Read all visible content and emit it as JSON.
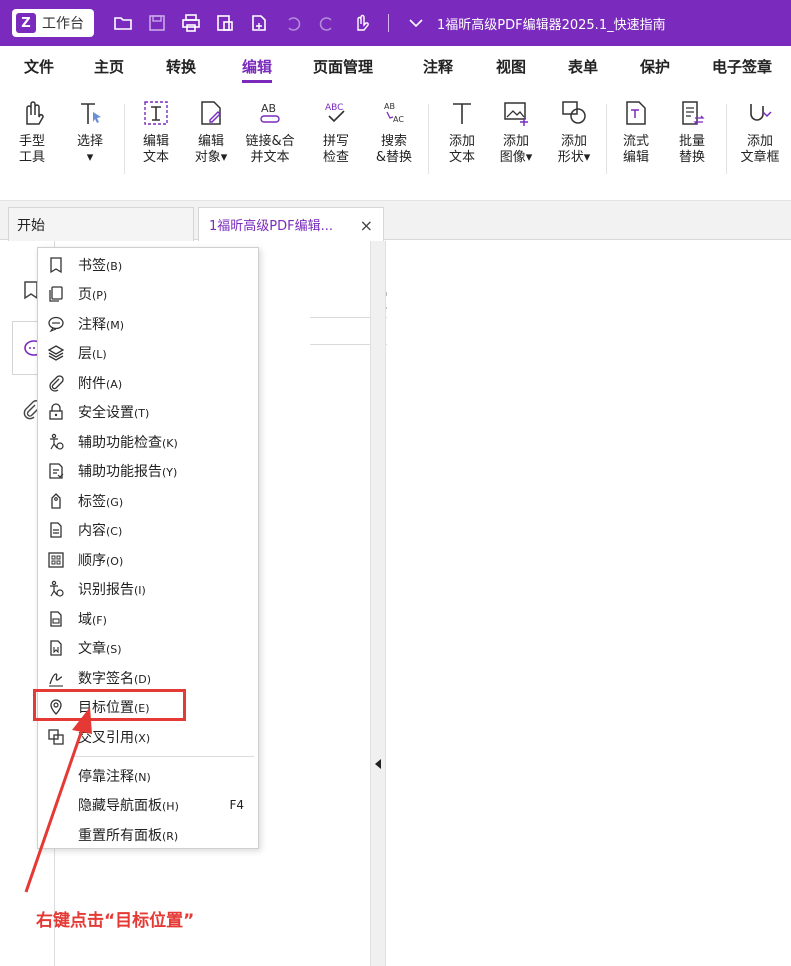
{
  "titlebar": {
    "workbench_label": "工作台",
    "logo_glyph": "Z",
    "doc_title": "1福昕高级PDF编辑器2025.1_快速指南"
  },
  "menu": {
    "tabs": [
      "文件",
      "主页",
      "转换",
      "编辑",
      "页面管理",
      "注释",
      "视图",
      "表单",
      "保护",
      "电子签章"
    ],
    "active": "编辑"
  },
  "ribbon": {
    "buttons": [
      {
        "l1": "手型",
        "l2": "工具",
        "icon": "hand-icon"
      },
      {
        "l1": "选择",
        "l2": "▾",
        "icon": "select-icon"
      },
      {
        "l1": "编辑",
        "l2": "文本",
        "icon": "edit-text-icon"
      },
      {
        "l1": "编辑",
        "l2": "对象▾",
        "icon": "edit-object-icon"
      },
      {
        "l1": "链接&合",
        "l2": "并文本",
        "icon": "link-merge-text-icon"
      },
      {
        "l1": "拼写",
        "l2": "检查",
        "icon": "spell-check-icon"
      },
      {
        "l1": "搜索",
        "l2": "&替换",
        "icon": "search-replace-icon"
      },
      {
        "l1": "添加",
        "l2": "文本",
        "icon": "add-text-icon"
      },
      {
        "l1": "添加",
        "l2": "图像▾",
        "icon": "add-image-icon"
      },
      {
        "l1": "添加",
        "l2": "形状▾",
        "icon": "add-shape-icon"
      },
      {
        "l1": "流式",
        "l2": "编辑",
        "icon": "flow-edit-icon"
      },
      {
        "l1": "批量",
        "l2": "替换",
        "icon": "batch-replace-icon"
      },
      {
        "l1": "添加",
        "l2": "文章框",
        "icon": "add-article-box-icon"
      }
    ]
  },
  "doctabs": {
    "home": "开始",
    "doc": "1福昕高级PDF编辑...",
    "close": "×"
  },
  "context_menu": {
    "items": [
      {
        "label": "书签",
        "acc": "(B)",
        "icon": "bookmark-icon"
      },
      {
        "label": "页",
        "acc": "(P)",
        "icon": "pages-icon"
      },
      {
        "label": "注释",
        "acc": "(M)",
        "icon": "comment-icon"
      },
      {
        "label": "层",
        "acc": "(L)",
        "icon": "layers-icon"
      },
      {
        "label": "附件",
        "acc": "(A)",
        "icon": "attachment-icon"
      },
      {
        "label": "安全设置",
        "acc": "(T)",
        "icon": "lock-icon"
      },
      {
        "label": "辅助功能检查",
        "acc": "(K)",
        "icon": "accessibility-check-icon"
      },
      {
        "label": "辅助功能报告",
        "acc": "(Y)",
        "icon": "accessibility-report-icon"
      },
      {
        "label": "标签",
        "acc": "(G)",
        "icon": "tag-icon"
      },
      {
        "label": "内容",
        "acc": "(C)",
        "icon": "content-icon"
      },
      {
        "label": "顺序",
        "acc": "(O)",
        "icon": "order-icon"
      },
      {
        "label": "识别报告",
        "acc": "(I)",
        "icon": "recognition-report-icon"
      },
      {
        "label": "域",
        "acc": "(F)",
        "icon": "fields-icon"
      },
      {
        "label": "文章",
        "acc": "(S)",
        "icon": "articles-icon"
      },
      {
        "label": "数字签名",
        "acc": "(D)",
        "icon": "digital-signature-icon"
      },
      {
        "label": "目标位置",
        "acc": "(E)",
        "icon": "destination-icon"
      },
      {
        "label": "交叉引用",
        "acc": "(X)",
        "icon": "cross-reference-icon"
      },
      {
        "label": "停靠注释",
        "acc": "(N)",
        "icon": ""
      },
      {
        "label": "隐藏导航面板",
        "acc": "(H)",
        "icon": "",
        "shortcut": "F4"
      },
      {
        "label": "重置所有面板",
        "acc": "(R)",
        "icon": ""
      }
    ]
  },
  "annotation": {
    "text": "右键点击“目标位置”",
    "color": "#e53935"
  },
  "colors": {
    "brand": "#7a2bbd",
    "highlight": "#e53935"
  }
}
